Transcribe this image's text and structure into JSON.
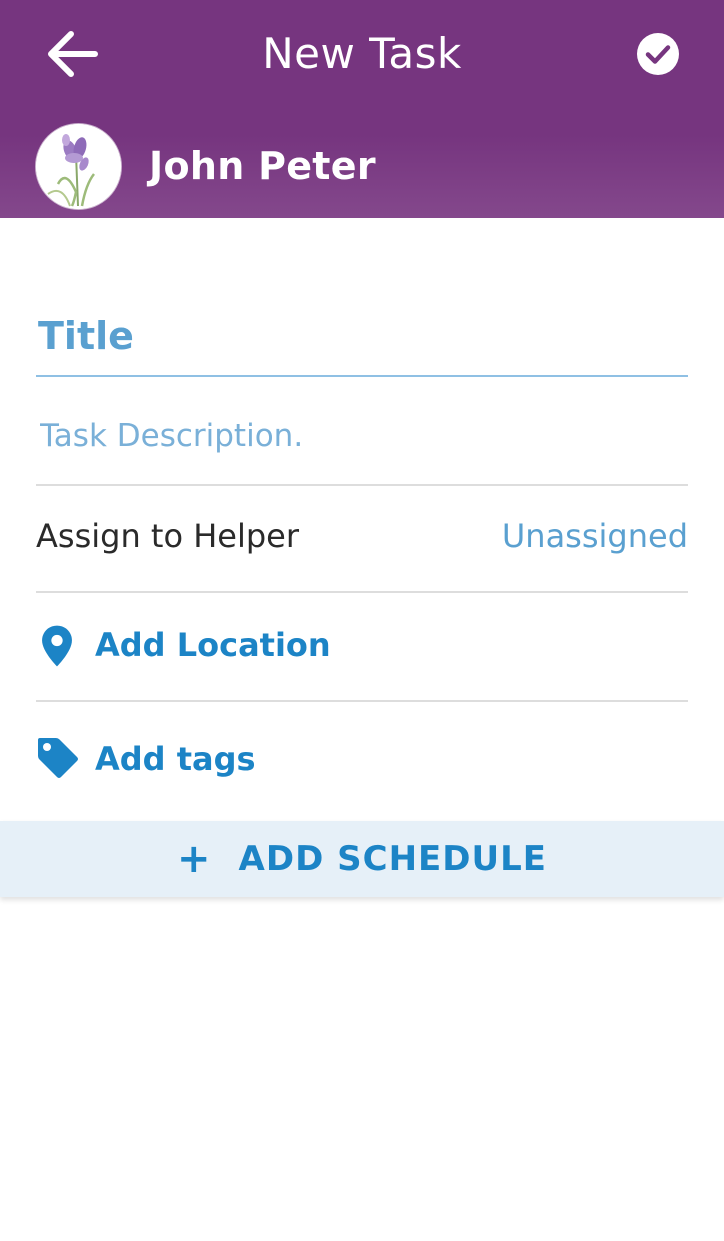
{
  "header": {
    "title": "New Task",
    "back_icon": "arrow-left-icon",
    "confirm_icon": "check-circle-icon",
    "background": "#76357f"
  },
  "user": {
    "name": "John Peter",
    "avatar_icon": "iris-flower-avatar"
  },
  "form": {
    "title_placeholder": "Title",
    "description_placeholder": "Task Description.",
    "assign_label": "Assign to Helper",
    "assign_value": "Unassigned",
    "location_label": "Add Location",
    "location_icon": "location-pin-icon",
    "tags_label": "Add tags",
    "tags_icon": "tag-icon"
  },
  "schedule": {
    "plus": "+",
    "label": "ADD SCHEDULE",
    "background": "#e6f0f8"
  },
  "colors": {
    "accent": "#1c84c6",
    "placeholder": "#5aa0d0"
  }
}
